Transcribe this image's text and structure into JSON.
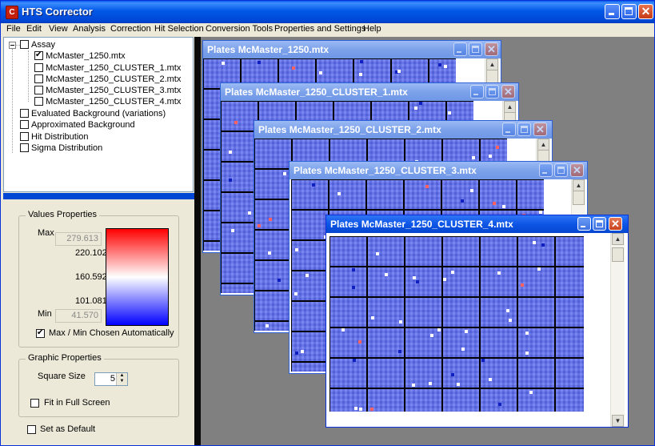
{
  "window": {
    "title": "HTS Corrector",
    "icon_letter": "C"
  },
  "menu": [
    "File",
    "Edit",
    "View",
    "Analysis",
    "Correction",
    "Hit Selection",
    "Conversion Tools",
    "Properties and Settings",
    "Help"
  ],
  "tree": {
    "root": "Assay",
    "children": [
      "McMaster_1250.mtx",
      "McMaster_1250_CLUSTER_1.mtx",
      "McMaster_1250_CLUSTER_2.mtx",
      "McMaster_1250_CLUSTER_3.mtx",
      "McMaster_1250_CLUSTER_4.mtx"
    ],
    "checked_child": 0,
    "others": [
      "Evaluated Background (variations)",
      "Approximated Background",
      "Hit Distribution",
      "Sigma Distribution"
    ]
  },
  "values_properties": {
    "legend": "Values Properties",
    "max_label": "Max",
    "max_value": "279.613",
    "ticks": [
      "220.102",
      "160.592",
      "101.081"
    ],
    "min_label": "Min",
    "min_value": "41.570",
    "auto_label": "Max / Min Chosen Automatically",
    "auto_checked": true,
    "colors": {
      "high": "#ff0000",
      "mid": "#ffffff",
      "low": "#0000ff"
    }
  },
  "graphic_properties": {
    "legend": "Graphic Properties",
    "square_size_label": "Square Size",
    "square_size": "5",
    "fit_label": "Fit in Full Screen"
  },
  "set_default_label": "Set as Default",
  "windows": [
    "Plates McMaster_1250.mtx",
    "Plates McMaster_1250_CLUSTER_1.mtx",
    "Plates McMaster_1250_CLUSTER_2.mtx",
    "Plates McMaster_1250_CLUSTER_3.mtx",
    "Plates McMaster_1250_CLUSTER_4.mtx"
  ],
  "plate_color": "#5d6df0"
}
